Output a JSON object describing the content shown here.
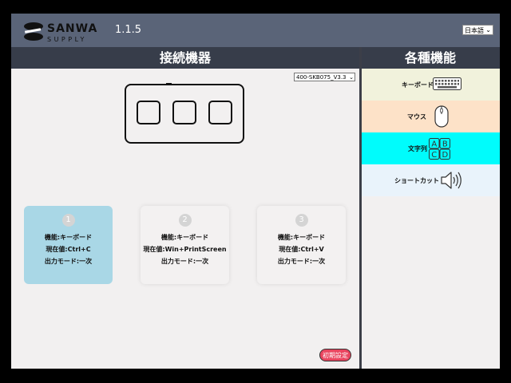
{
  "header": {
    "brand_logo": "SANWA SUPPLY",
    "version": "1.1.5",
    "language_select": "日本語"
  },
  "panels": {
    "left_title": "接続機器",
    "right_title": "各種機能"
  },
  "device": {
    "model_select": "400-SKB075_V3.3"
  },
  "keys": [
    {
      "number": "1",
      "function": "機能:キーボード",
      "current": "現在値:Ctrl+C",
      "mode": "出力モード:一次",
      "selected": true
    },
    {
      "number": "2",
      "function": "機能:キーボード",
      "current": "現在値:Win+PrintScreen",
      "mode": "出力モード:一次",
      "selected": false
    },
    {
      "number": "3",
      "function": "機能:キーボード",
      "current": "現在値:Ctrl+V",
      "mode": "出力モード:一次",
      "selected": false
    }
  ],
  "reset_button": "初期設定",
  "functions": [
    {
      "label": "キーボード",
      "icon": "keyboard-icon",
      "color": "#f1f2dc"
    },
    {
      "label": "マウス",
      "icon": "mouse-icon",
      "color": "#fde2c8"
    },
    {
      "label": "文字列",
      "icon": "abcd-icon",
      "color": "#00fcfc"
    },
    {
      "label": "ショートカット",
      "icon": "speaker-icon",
      "color": "#e9f3fb"
    }
  ],
  "colors": {
    "header_bg": "#5a6478",
    "panel_title_bg": "#373d4a",
    "selected_card": "#a9d7e6",
    "reset_button": "#e9455f"
  }
}
